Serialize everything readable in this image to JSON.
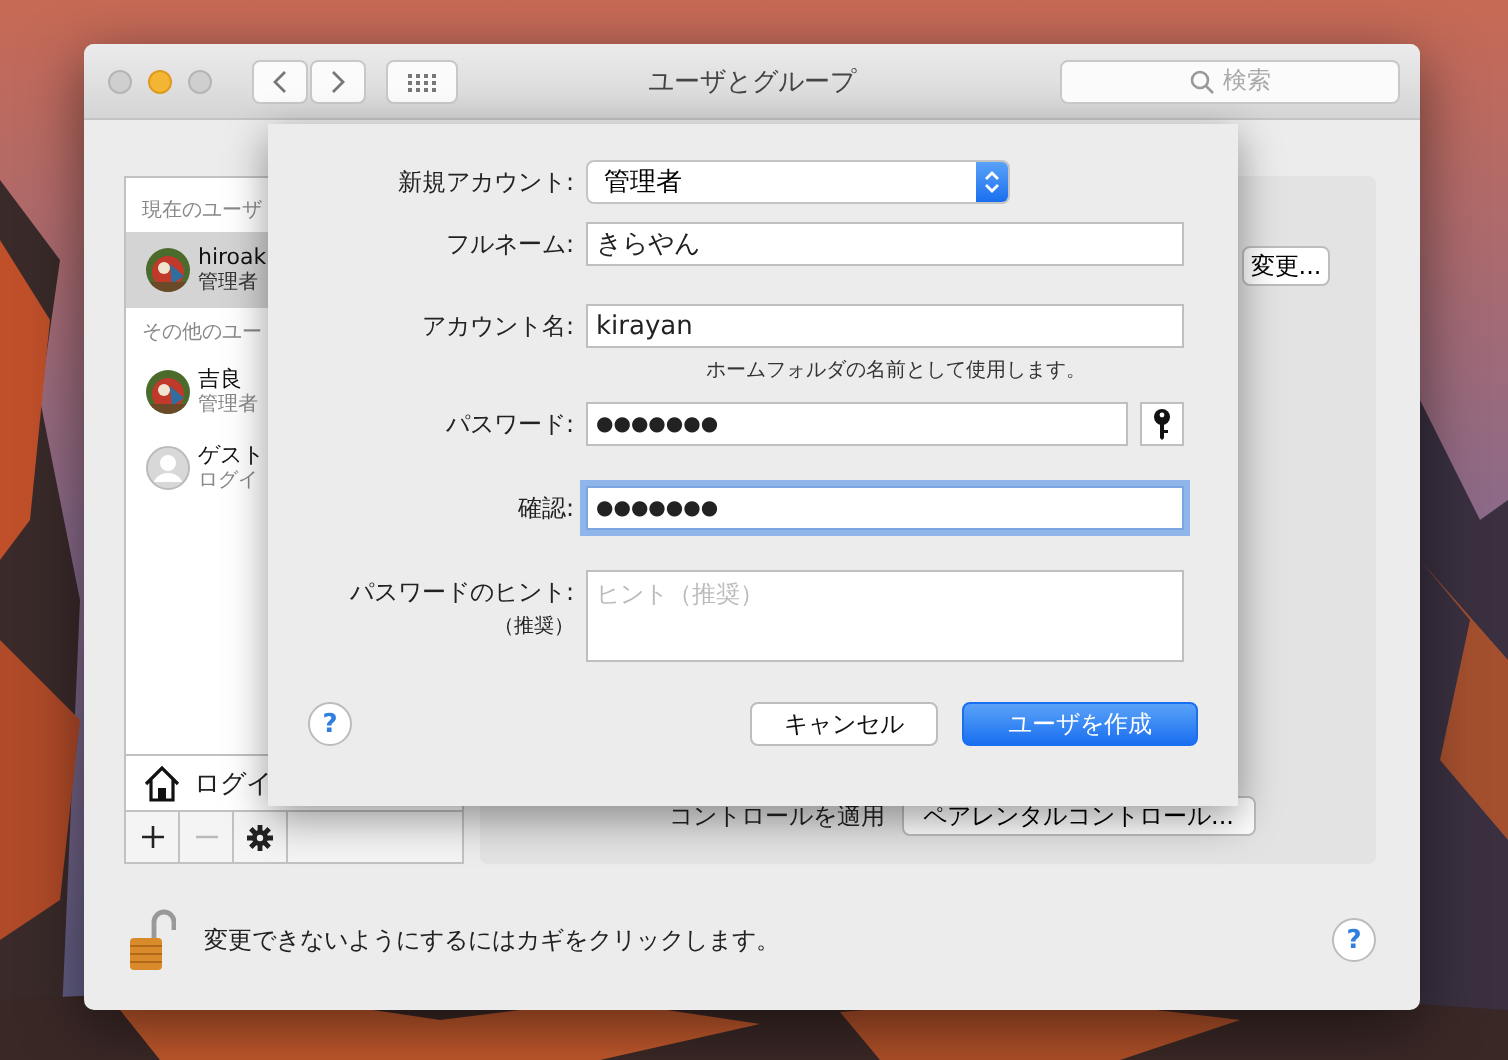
{
  "window": {
    "title": "ユーザとグループ",
    "search": {
      "placeholder": "検索"
    }
  },
  "sidebar": {
    "sections": [
      {
        "header": "現在のユーザ",
        "users": [
          {
            "name": "hiroak",
            "role": "管理者",
            "selected": true
          }
        ]
      },
      {
        "header": "その他のユー",
        "users": [
          {
            "name": "吉良",
            "role": "管理者",
            "selected": false
          },
          {
            "name": "ゲスト",
            "role": "ログイ",
            "selected": false,
            "kind": "silhouette"
          }
        ]
      }
    ],
    "login_options": "ログイ"
  },
  "panel": {
    "change_button": "変更...",
    "parental_label": "コントロールを適用",
    "parental_button": "ペアレンタルコントロール..."
  },
  "lock_text": "変更できないようにするにはカギをクリックします。",
  "help_button": "?",
  "sheet": {
    "fields": [
      {
        "kind": "popup",
        "label": "新規アカウント:",
        "value": "管理者"
      },
      {
        "kind": "text",
        "label": "フルネーム:",
        "value": "きらやん",
        "focused": false
      },
      {
        "kind": "text",
        "label": "アカウント名:",
        "value": "kirayan",
        "note": "ホームフォルダの名前として使用します。",
        "focused": false
      },
      {
        "kind": "password",
        "label": "パスワード:",
        "value": "●●●●●●●",
        "focused": false
      },
      {
        "kind": "password",
        "label": "確認:",
        "value": "●●●●●●●",
        "focused": true
      },
      {
        "kind": "textarea",
        "label": "パスワードのヒント:",
        "sublabel": "（推奨）",
        "placeholder": "ヒント（推奨）"
      }
    ],
    "buttons": [
      {
        "label": "キャンセル",
        "default": false
      },
      {
        "label": "ユーザを作成",
        "default": true
      }
    ],
    "help_button": "?"
  }
}
